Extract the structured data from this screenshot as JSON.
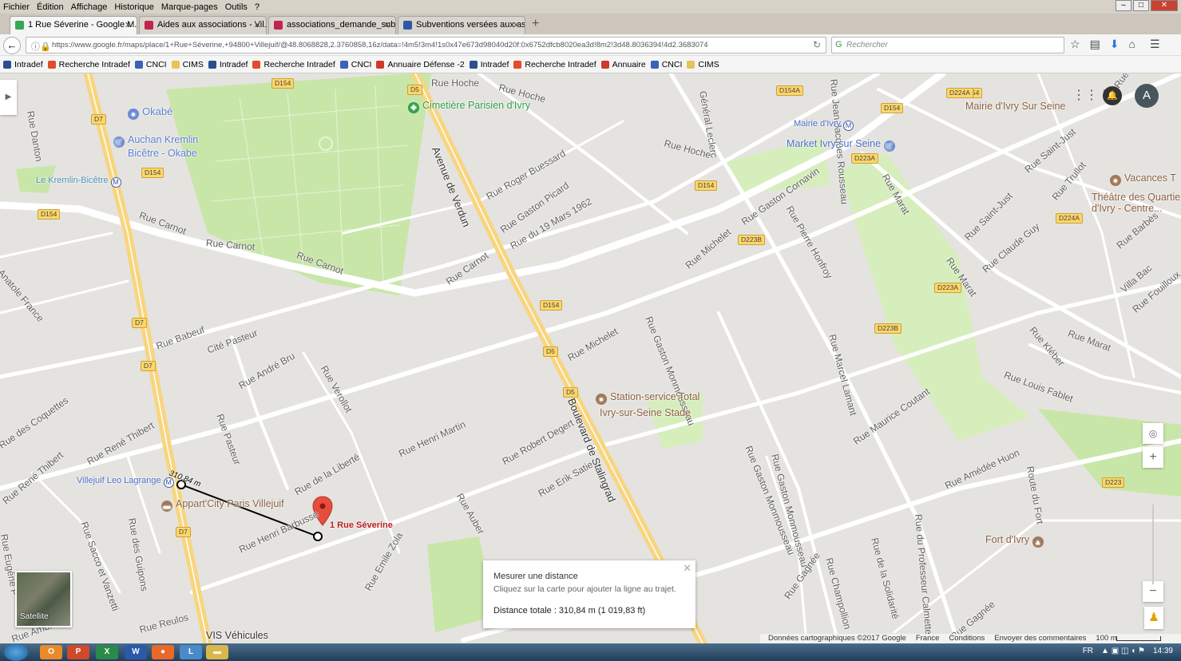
{
  "browser": {
    "menu": [
      "Fichier",
      "Édition",
      "Affichage",
      "Historique",
      "Marque-pages",
      "Outils",
      "?"
    ],
    "tabs": [
      {
        "label": "1 Rue Séverine - Google M...",
        "color": "#34a853"
      },
      {
        "label": "Aides aux associations - Vil...",
        "color": "#c0264b"
      },
      {
        "label": "associations_demande_sub...",
        "color": "#c0264b"
      },
      {
        "label": "Subventions versées aux as...",
        "color": "#3057a8"
      }
    ],
    "new_tab": "+",
    "url": "https://www.google.fr/maps/place/1+Rue+Séverine,+94800+Villejuif/@48.8068828,2.3760858,16z/data=!4m5!3m4!1s0x47e673d98040d20f:0x6752dfcb8020ea3d!8m2!3d48.8036394!4d2.3683074",
    "search_placeholder": "Rechercher",
    "bookmarks": [
      {
        "label": "Intradef",
        "color": "#2a4f8f"
      },
      {
        "label": "Recherche Intradef",
        "color": "#e14d2a"
      },
      {
        "label": "CNCI",
        "color": "#3a62b8"
      },
      {
        "label": "CIMS",
        "color": "#e8c35a"
      },
      {
        "label": "Intradef",
        "color": "#2a4f8f"
      },
      {
        "label": "Recherche Intradef",
        "color": "#e14d2a"
      },
      {
        "label": "CNCI",
        "color": "#3a62b8"
      },
      {
        "label": "Annuaire Défense -2",
        "color": "#d03a2a"
      },
      {
        "label": "Intradef",
        "color": "#2a4f8f"
      },
      {
        "label": "Recherche Intradef",
        "color": "#e14d2a"
      },
      {
        "label": "Annuaire",
        "color": "#d03a2a"
      },
      {
        "label": "CNCI",
        "color": "#3a62b8"
      },
      {
        "label": "CIMS",
        "color": "#e8c35a"
      }
    ]
  },
  "map": {
    "avatar_letter": "A",
    "streets": [
      "Rue Danton",
      "Rue Carnot",
      "Rue Carnot",
      "Rue Carnot",
      "Rue Carnot",
      "Anatole France",
      "Rue Babeuf",
      "Cité Pasteur",
      "Rue André Bru",
      "Rue Verollot",
      "Rue des Coquettes",
      "Rue René Thibert",
      "Rue René Thibert",
      "Rue Pasteur",
      "Rue de la Liberté",
      "Rue Henri Barbusse",
      "Rue Henri Martin",
      "Rue Sacco et Vanzetti",
      "Rue des Guipons",
      "Rue Eugène P",
      "Rue Hoche",
      "Rue Hoche",
      "Rue Hoche",
      "Rue Roger Buessard",
      "Rue Gaston Picard",
      "Rue du 19 Mars 1962",
      "Avenue de Verdun",
      "Boulevard de Stalingrad",
      "Rue Michelet",
      "Rue Michelet",
      "Rue Gaston Cornavin",
      "Rue Pierre Honfroy",
      "Rue Gaston Monmousseau",
      "Rue Gaston Monmousseau",
      "Rue Robert Degert",
      "Rue Erik Satie",
      "Rue Auber",
      "Rue Emile Zola",
      "Rue Reulos",
      "Rue Ambroise",
      "Rue Marcel Lamant",
      "Rue Maurice Coutant",
      "Rue Louis Fablet",
      "Rue Kléber",
      "Rue Marat",
      "Rue Marat",
      "Rue Marat",
      "Rue Saint-Just",
      "Rue Saint-Just",
      "Rue Claude Guy",
      "Rue Trullot",
      "Villa Bac",
      "Rue Fouilloux",
      "Rue Amédée Huon",
      "Route du Fort",
      "Rue du Professeur Calmette",
      "Rue de la Solidarité",
      "Rue Champollion",
      "Rue Gagnée",
      "Rue Gagnée",
      "Général Leclerc",
      "Rue Jean-Jacques Rousseau",
      "Rue Saint-",
      "Rue Barbès",
      "Rue Gaston Monmousseau"
    ],
    "road_shields": [
      "D154",
      "D154",
      "D154",
      "D154",
      "D154",
      "D154",
      "D154A",
      "D154",
      "D224A",
      "D5",
      "D5",
      "D5",
      "D7",
      "D7",
      "D7",
      "D7",
      "D223A",
      "D223A",
      "D223B",
      "D223B",
      "D224A",
      "D223"
    ],
    "pois": [
      {
        "label": "Okabé",
        "color": "#6b8ad6"
      },
      {
        "label": "Auchan Kremlin",
        "label2": "Bicêtre - Okabe",
        "color": "#6b8ad6"
      },
      {
        "label": "Le Kremlin-Bicêtre",
        "color": "#4a8cb6"
      },
      {
        "label": "Cimetière Parisien d'Ivry",
        "color": "#2f9e4a"
      },
      {
        "label": "Mairie d'Ivry",
        "color": "#4a6ec8"
      },
      {
        "label": "Market Ivry sur Seine",
        "color": "#4a6ec8"
      },
      {
        "label": "Mairie d'Ivry Sur Seine",
        "color": "#a0795a"
      },
      {
        "label": "Vacances T",
        "color": "#a0795a"
      },
      {
        "label": "Théâtre des Quartie",
        "label2": "d'Ivry - Centre...",
        "color": "#a0795a"
      },
      {
        "label": "Station-service Total",
        "color": "#a0795a"
      },
      {
        "label": "Ivry-sur-Seine Stade",
        "color": "#a0795a"
      },
      {
        "label": "Villejuif Leo Lagrange",
        "color": "#4a6ec8"
      },
      {
        "label": "Appart'City Paris Villejuif",
        "color": "#a0795a"
      },
      {
        "label": "Fort d'Ivry",
        "color": "#a0795a"
      },
      {
        "label": "VIS Véhicules",
        "color": "#333333"
      }
    ],
    "marker_label": "1 Rue Séverine",
    "marker_color": "#b71c1c",
    "measure_line_label": "310,84 m",
    "satellite_label": "Satellite",
    "measure_panel": {
      "title": "Mesurer une distance",
      "subtitle": "Cliquez sur la carte pour ajouter la ligne au trajet.",
      "distance": "Distance totale : 310,84 m (1 019,83 ft)"
    },
    "footer": [
      "Données cartographiques ©2017 Google",
      "France",
      "Conditions",
      "Envoyer des commentaires",
      "100 m"
    ]
  },
  "taskbar": {
    "apps": [
      {
        "label": "O",
        "color": "#e88a2a"
      },
      {
        "label": "P",
        "color": "#d04a2a"
      },
      {
        "label": "X",
        "color": "#2a8a4a"
      },
      {
        "label": "W",
        "color": "#2a5aa8"
      },
      {
        "label": "●",
        "color": "#e8692a"
      },
      {
        "label": "L",
        "color": "#4a8ac8"
      },
      {
        "label": "▬",
        "color": "#d8b84a"
      }
    ],
    "language": "FR",
    "clock": "14:39"
  }
}
